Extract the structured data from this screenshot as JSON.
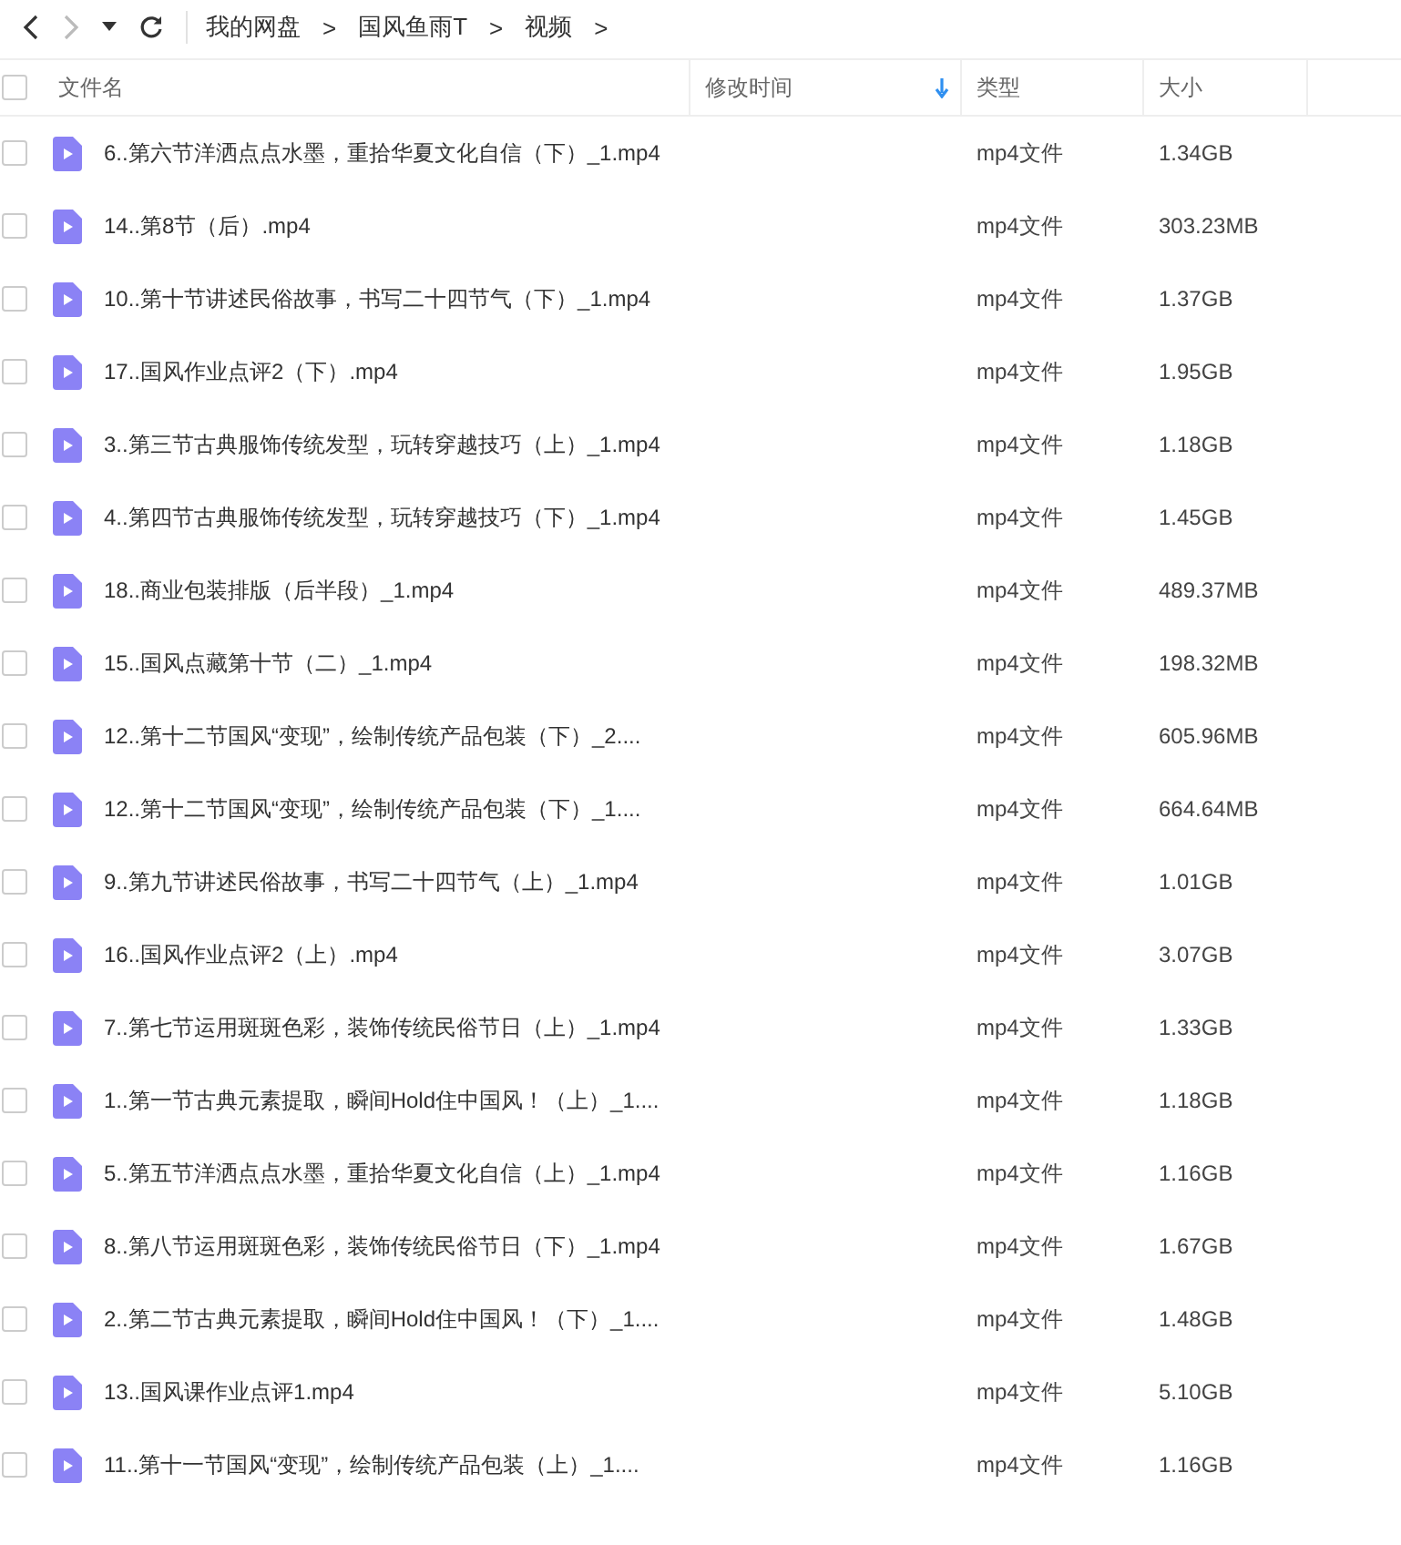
{
  "breadcrumbs": [
    "我的网盘",
    "国风鱼雨T",
    "视频"
  ],
  "breadcrumb_separator": ">",
  "table": {
    "select_all": {
      "checked": false
    },
    "columns": [
      {
        "label": "文件名",
        "sorted": false
      },
      {
        "label": "修改时间",
        "sorted": true
      },
      {
        "label": "类型",
        "sorted": false
      },
      {
        "label": "大小",
        "sorted": false
      }
    ],
    "rows": [
      {
        "name": "6..第六节洋洒点点水墨，重拾华夏文化自信（下）_1.mp4",
        "type": "mp4文件",
        "size": "1.34GB",
        "selected": false
      },
      {
        "name": "14..第8节（后）.mp4",
        "type": "mp4文件",
        "size": "303.23MB",
        "selected": false
      },
      {
        "name": "10..第十节讲述民俗故事，书写二十四节气（下）_1.mp4",
        "type": "mp4文件",
        "size": "1.37GB",
        "selected": false
      },
      {
        "name": "17..国风作业点评2（下）.mp4",
        "type": "mp4文件",
        "size": "1.95GB",
        "selected": false
      },
      {
        "name": "3..第三节古典服饰传统发型，玩转穿越技巧（上）_1.mp4",
        "type": "mp4文件",
        "size": "1.18GB",
        "selected": false
      },
      {
        "name": "4..第四节古典服饰传统发型，玩转穿越技巧（下）_1.mp4",
        "type": "mp4文件",
        "size": "1.45GB",
        "selected": false
      },
      {
        "name": "18..商业包装排版（后半段）_1.mp4",
        "type": "mp4文件",
        "size": "489.37MB",
        "selected": false
      },
      {
        "name": "15..国风点藏第十节（二）_1.mp4",
        "type": "mp4文件",
        "size": "198.32MB",
        "selected": false
      },
      {
        "name": "12..第十二节国风“变现”，绘制传统产品包装（下）_2....",
        "type": "mp4文件",
        "size": "605.96MB",
        "selected": false
      },
      {
        "name": "12..第十二节国风“变现”，绘制传统产品包装（下）_1....",
        "type": "mp4文件",
        "size": "664.64MB",
        "selected": false
      },
      {
        "name": "9..第九节讲述民俗故事，书写二十四节气（上）_1.mp4",
        "type": "mp4文件",
        "size": "1.01GB",
        "selected": false
      },
      {
        "name": "16..国风作业点评2（上）.mp4",
        "type": "mp4文件",
        "size": "3.07GB",
        "selected": false
      },
      {
        "name": "7..第七节运用斑斑色彩，装饰传统民俗节日（上）_1.mp4",
        "type": "mp4文件",
        "size": "1.33GB",
        "selected": false
      },
      {
        "name": "1..第一节古典元素提取，瞬间Hold住中国风！（上）_1....",
        "type": "mp4文件",
        "size": "1.18GB",
        "selected": false
      },
      {
        "name": "5..第五节洋洒点点水墨，重拾华夏文化自信（上）_1.mp4",
        "type": "mp4文件",
        "size": "1.16GB",
        "selected": false
      },
      {
        "name": "8..第八节运用斑斑色彩，装饰传统民俗节日（下）_1.mp4",
        "type": "mp4文件",
        "size": "1.67GB",
        "selected": false
      },
      {
        "name": "2..第二节古典元素提取，瞬间Hold住中国风！（下）_1....",
        "type": "mp4文件",
        "size": "1.48GB",
        "selected": false
      },
      {
        "name": "13..国风课作业点评1.mp4",
        "type": "mp4文件",
        "size": "5.10GB",
        "selected": false
      },
      {
        "name": "11..第十一节国风“变现”，绘制传统产品包装（上）_1....",
        "type": "mp4文件",
        "size": "1.16GB",
        "selected": false
      }
    ]
  }
}
